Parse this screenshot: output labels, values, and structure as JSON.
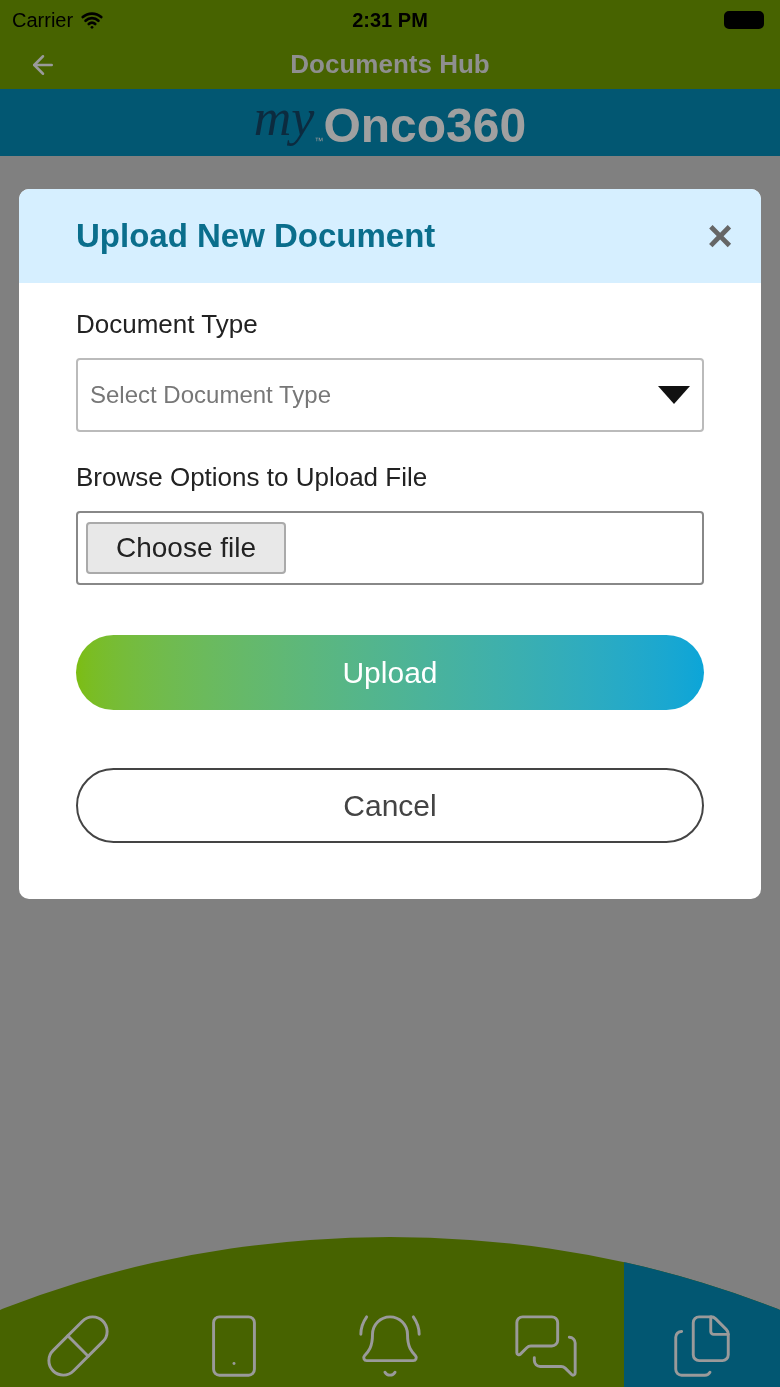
{
  "status_bar": {
    "carrier": "Carrier",
    "time": "2:31 PM"
  },
  "nav_bar": {
    "title": "Documents Hub"
  },
  "logo": {
    "script": "my",
    "trademark": "™",
    "wordmark": "Onco360"
  },
  "dialog": {
    "title": "Upload New Document",
    "close": "×",
    "fields": [
      {
        "kind": "select",
        "label": "Document Type",
        "placeholder": "Select Document Type"
      },
      {
        "kind": "file",
        "label": "Browse Options to Upload File",
        "button": "Choose file"
      }
    ],
    "buttons": [
      {
        "kind": "primary",
        "label": "Upload"
      },
      {
        "kind": "secondary",
        "label": "Cancel"
      }
    ]
  },
  "tab_bar": [
    {
      "kind": "pills",
      "selected": false
    },
    {
      "kind": "payment",
      "selected": false
    },
    {
      "kind": "bell",
      "selected": false
    },
    {
      "kind": "support",
      "selected": false
    },
    {
      "kind": "documents",
      "selected": true
    }
  ]
}
